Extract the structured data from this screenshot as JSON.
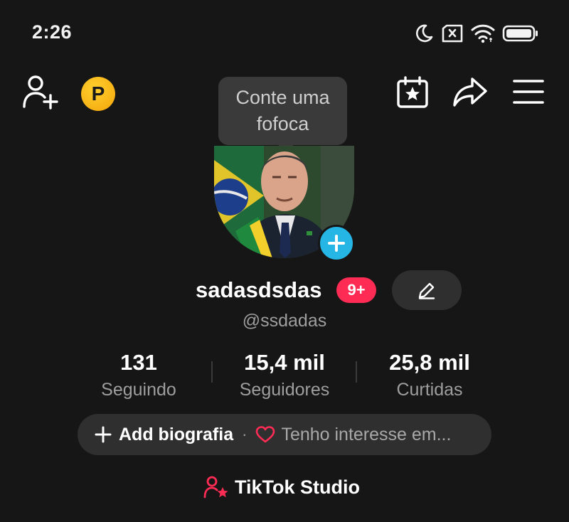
{
  "status_bar": {
    "time": "2:26",
    "icons": [
      "moon-icon",
      "no-sim-icon",
      "wifi-icon",
      "battery-icon"
    ]
  },
  "top_bar": {
    "icons": [
      "add-user-icon",
      "coin-icon",
      "calendar-star-icon",
      "share-icon",
      "menu-icon"
    ],
    "coin_letter": "P"
  },
  "tooltip": {
    "text": "Conte uma fofoca"
  },
  "profile": {
    "name": "sadasdsdas",
    "notification_badge": "9+",
    "handle": "@ssdadas"
  },
  "stats": [
    {
      "value": "131",
      "label": "Seguindo"
    },
    {
      "value": "15,4 mil",
      "label": "Seguidores"
    },
    {
      "value": "25,8 mil",
      "label": "Curtidas"
    }
  ],
  "bio": {
    "add_label": "Add biografia",
    "separator": "·",
    "interest_label": "Tenho interesse em..."
  },
  "studio": {
    "label": "TikTok Studio"
  },
  "colors": {
    "background": "#161616",
    "accent_red": "#fe2c55",
    "accent_blue": "#25b6e6",
    "coin_gold": "#f3a50a",
    "pill_bg": "#2f2f2f",
    "muted_text": "#9e9e9e"
  }
}
